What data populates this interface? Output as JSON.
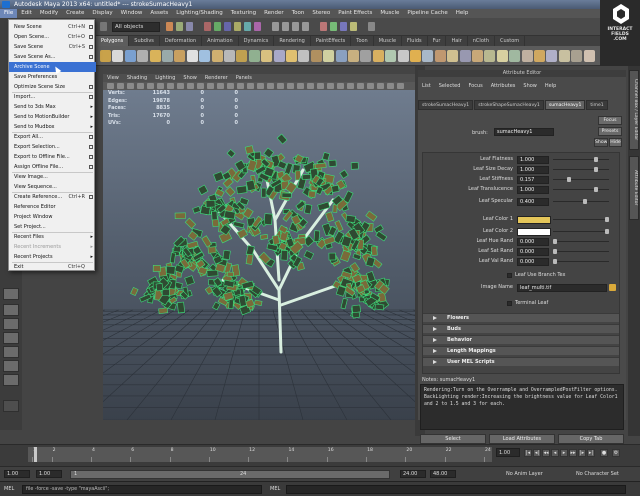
{
  "window": {
    "title": "Autodesk Maya 2013 x64: untitled*   ---   strokeSumacHeavy1"
  },
  "menubar": {
    "items": [
      "File",
      "Edit",
      "Modify",
      "Create",
      "Display",
      "Window",
      "Assets",
      "Lighting/Shading",
      "Texturing",
      "Render",
      "Toon",
      "Stereo",
      "Paint Effects",
      "Muscle",
      "Pipeline Cache",
      "Help"
    ]
  },
  "status_line": {
    "object_field": "All objects"
  },
  "shelf": {
    "tabs": [
      "Polygons",
      "Subdivs",
      "Deformation",
      "Animation",
      "Dynamics",
      "Rendering",
      "PaintEffects",
      "Toon",
      "Muscle",
      "Fluids",
      "Fur",
      "Hair",
      "nCloth",
      "Custom"
    ],
    "active_tab": "Polygons"
  },
  "logo": {
    "line1": "INTERACT",
    "line2": "FIELDS",
    "line3": ".COM"
  },
  "file_menu": {
    "items": [
      {
        "label": "New Scene",
        "shortcut": "Ctrl+N",
        "box": true
      },
      {
        "label": "Open Scene...",
        "shortcut": "Ctrl+O",
        "box": true
      },
      {
        "label": "Save Scene",
        "shortcut": "Ctrl+S",
        "box": true
      },
      {
        "label": "Save Scene As...",
        "shortcut": "",
        "box": true
      },
      {
        "label": "Archive Scene",
        "shortcut": "",
        "box": false,
        "highlight": true
      },
      {
        "label": "Save Preferences",
        "shortcut": "",
        "box": false
      },
      {
        "label": "Optimize Scene Size",
        "shortcut": "",
        "box": true
      },
      {
        "label": "Import...",
        "shortcut": "",
        "box": true
      },
      {
        "label": "Send to 3ds Max",
        "shortcut": "",
        "arrow": true
      },
      {
        "label": "Send to MotionBuilder",
        "shortcut": "",
        "arrow": true
      },
      {
        "label": "Send to Mudbox",
        "shortcut": "",
        "arrow": true
      },
      {
        "label": "Export All...",
        "shortcut": "",
        "box": true
      },
      {
        "label": "Export Selection...",
        "shortcut": "",
        "box": true
      },
      {
        "label": "Export to Offline File...",
        "shortcut": "",
        "box": true
      },
      {
        "label": "Assign Offline File...",
        "shortcut": "",
        "box": true
      },
      {
        "label": "View Image...",
        "shortcut": ""
      },
      {
        "label": "View Sequence...",
        "shortcut": ""
      },
      {
        "label": "Create Reference...",
        "shortcut": "Ctrl+R",
        "box": true
      },
      {
        "label": "Reference Editor",
        "shortcut": ""
      },
      {
        "label": "Project Window",
        "shortcut": ""
      },
      {
        "label": "Set Project...",
        "shortcut": ""
      },
      {
        "label": "Recent Files",
        "shortcut": "",
        "arrow": true
      },
      {
        "label": "Recent Increments",
        "shortcut": "",
        "arrow": true,
        "disabled": true
      },
      {
        "label": "Recent Projects",
        "shortcut": "",
        "arrow": true
      },
      {
        "label": "Exit",
        "shortcut": "Ctrl+Q"
      }
    ]
  },
  "viewport": {
    "menu": [
      "View",
      "Shading",
      "Lighting",
      "Show",
      "Renderer",
      "Panels"
    ],
    "hud": [
      {
        "label": "Verts:",
        "a": "11643",
        "b": "0",
        "c": "0"
      },
      {
        "label": "Edges:",
        "a": "19878",
        "b": "0",
        "c": "0"
      },
      {
        "label": "Faces:",
        "a": "8835",
        "b": "0",
        "c": "0"
      },
      {
        "label": "Tris:",
        "a": "17670",
        "b": "0",
        "c": "0"
      },
      {
        "label": "UVs:",
        "a": "0",
        "b": "0",
        "c": "0"
      }
    ]
  },
  "attribute_editor": {
    "header": "Attribute Editor",
    "menu": [
      "List",
      "Selected",
      "Focus",
      "Attributes",
      "Show",
      "Help"
    ],
    "tabs": [
      "strokeSumacHeavy1",
      "strokeShapeSumacHeavy1",
      "sumacHeavy1",
      "time1"
    ],
    "active_tab": "sumacHeavy1",
    "brush_label": "brush:",
    "brush_value": "sumacHeavy1",
    "buttons": {
      "focus": "Focus",
      "presets": "Presets",
      "show": "Show",
      "hide": "Hide"
    },
    "rows": [
      {
        "label": "Leaf Flatness",
        "value": "1.000",
        "knob": 0.78
      },
      {
        "label": "Leaf Size Decay",
        "value": "1.000",
        "knob": 0.78
      },
      {
        "label": "Leaf Stiffness",
        "value": "0.157",
        "knob": 0.26
      },
      {
        "label": "Leaf Translucence",
        "value": "1.000",
        "knob": 0.78
      },
      {
        "label": "Leaf Specular",
        "value": "0.400",
        "knob": 0.58
      },
      {
        "label": "Leaf Color 1",
        "color": "#e5c65a"
      },
      {
        "label": "Leaf Color 2",
        "color": "#ffffff"
      },
      {
        "label": "Leaf Hue Rand",
        "value": "0.000",
        "knob": 0.0
      },
      {
        "label": "Leaf Sat Rand",
        "value": "0.000",
        "knob": 0.0
      },
      {
        "label": "Leaf Val Rand",
        "value": "0.000",
        "knob": 0.0
      }
    ],
    "use_branch_tex_label": "Leaf Use Branch Tex",
    "image_name_label": "Image Name",
    "image_name_value": "leaf_multi.tif",
    "terminal_leaf_label": "Terminal Leaf",
    "sections": [
      "Flowers",
      "Buds",
      "Behavior",
      "Length Mappings",
      "User MEL Scripts"
    ],
    "notes_label": "Notes:  sumacHeavy1",
    "notes_text": "Rendering:Turn on the Overrample and OverrampledPostFilter options. BackLighting render:Increasing the brightness value for Leaf Color1 and 2 to 1.5 and 3 for each.",
    "footer_buttons": [
      "Select",
      "Load Attributes",
      "Copy Tab"
    ]
  },
  "side_tabs": [
    "Channel Box / Layer Editor",
    "Attribute Editor"
  ],
  "time_slider": {
    "ticks": [
      "1",
      "2",
      "4",
      "6",
      "8",
      "10",
      "12",
      "14",
      "16",
      "18",
      "20",
      "22",
      "24"
    ],
    "current_frame": "1.00"
  },
  "range_slider": {
    "start": "1.00",
    "inner_start": "1.00",
    "marker": "1",
    "marker_end": "24",
    "end_a": "24.00",
    "end_b": "48.00",
    "anim_layer": "No Anim Layer",
    "char_set": "No Character Set"
  },
  "command_line": {
    "mel_label": "MEL",
    "input": "file -force -save -type \"mayaAscii\";",
    "result_label": "MEL"
  },
  "colors": {
    "accent_menu": "#3a71d3",
    "leaf_color_1": "#e5c65a",
    "leaf_color_2": "#ffffff",
    "wireframe": "#3ddb7a"
  }
}
